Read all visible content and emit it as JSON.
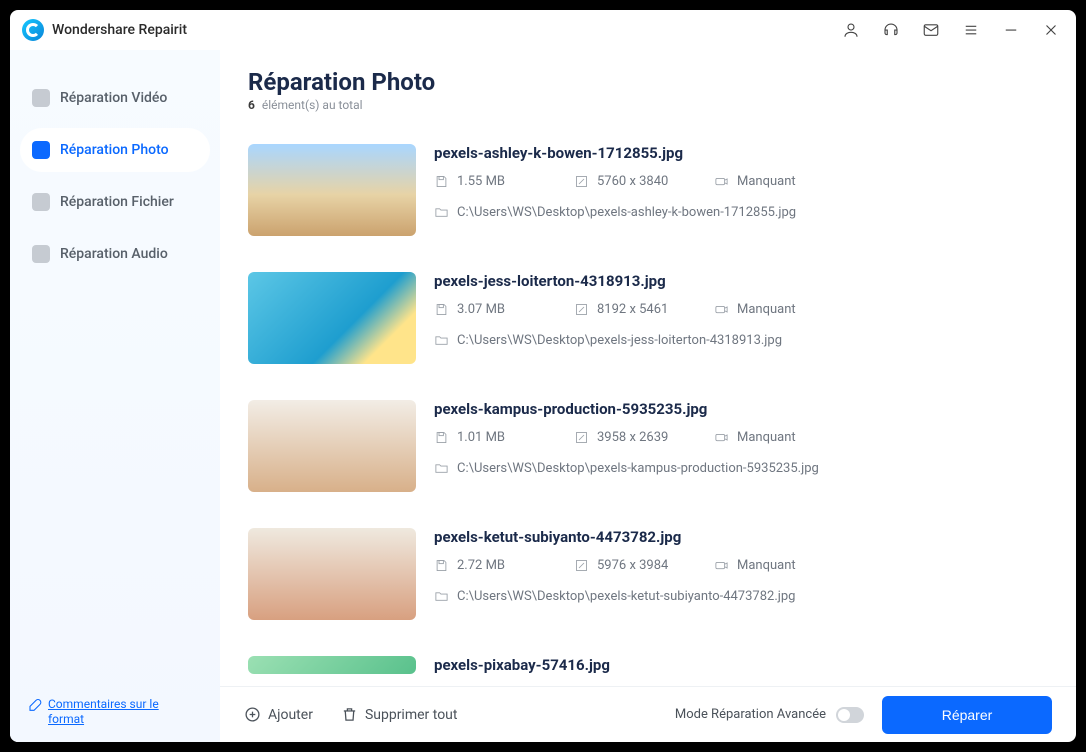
{
  "app": {
    "name": "Wondershare Repairit"
  },
  "sidebar": {
    "items": [
      {
        "label": "Réparation Vidéo",
        "active": false
      },
      {
        "label": "Réparation Photo",
        "active": true
      },
      {
        "label": "Réparation Fichier",
        "active": false
      },
      {
        "label": "Réparation Audio",
        "active": false
      }
    ],
    "feedback_label": "Commentaires sur le format"
  },
  "page": {
    "title": "Réparation Photo",
    "count": "6",
    "count_suffix": "élément(s) au total"
  },
  "files": [
    {
      "name": "pexels-ashley-k-bowen-1712855.jpg",
      "size": "1.55  MB",
      "dim": "5760 x 3840",
      "status": "Manquant",
      "path": "C:\\Users\\WS\\Desktop\\pexels-ashley-k-bowen-1712855.jpg"
    },
    {
      "name": "pexels-jess-loiterton-4318913.jpg",
      "size": "3.07  MB",
      "dim": "8192 x 5461",
      "status": "Manquant",
      "path": "C:\\Users\\WS\\Desktop\\pexels-jess-loiterton-4318913.jpg"
    },
    {
      "name": "pexels-kampus-production-5935235.jpg",
      "size": "1.01  MB",
      "dim": "3958 x 2639",
      "status": "Manquant",
      "path": "C:\\Users\\WS\\Desktop\\pexels-kampus-production-5935235.jpg"
    },
    {
      "name": "pexels-ketut-subiyanto-4473782.jpg",
      "size": "2.72  MB",
      "dim": "5976 x 3984",
      "status": "Manquant",
      "path": "C:\\Users\\WS\\Desktop\\pexels-ketut-subiyanto-4473782.jpg"
    },
    {
      "name": "pexels-pixabay-57416.jpg",
      "size": "",
      "dim": "",
      "status": "",
      "path": ""
    }
  ],
  "footer": {
    "add": "Ajouter",
    "delete_all": "Supprimer tout",
    "advanced": "Mode Réparation Avancée",
    "repair": "Réparer"
  }
}
